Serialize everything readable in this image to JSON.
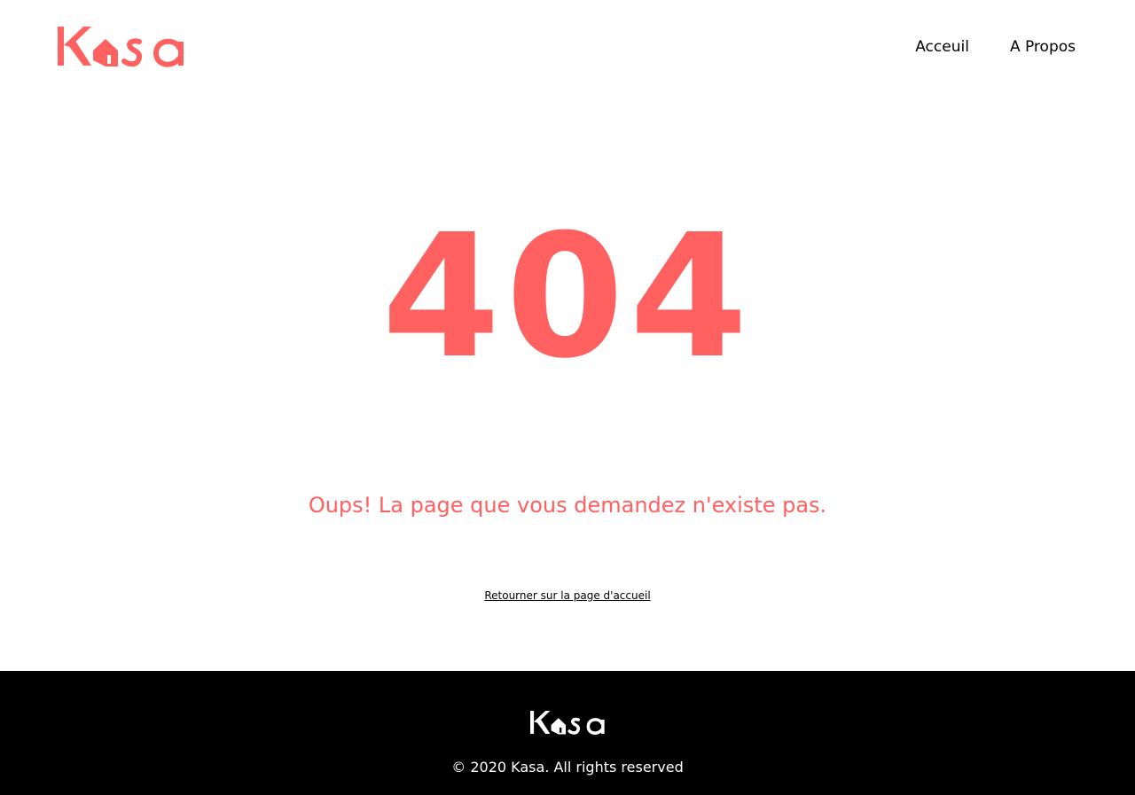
{
  "colors": {
    "accent": "#FF6060",
    "text": "#000000",
    "background": "#FFFFFF",
    "footer_background": "#000000",
    "footer_text": "#FFFFFF"
  },
  "header": {
    "logo_text": "Kasa",
    "nav": [
      {
        "label": "Acceuil",
        "icon": ""
      },
      {
        "label": "A Propos",
        "icon": ""
      }
    ]
  },
  "main": {
    "error_code": "404",
    "message": "Oups! La page que vous demandez n'existe pas.",
    "home_link_label": "Retourner sur la page d'accueil"
  },
  "footer": {
    "logo_text": "Kasa",
    "copyright": "© 2020 Kasa. All rights reserved"
  }
}
